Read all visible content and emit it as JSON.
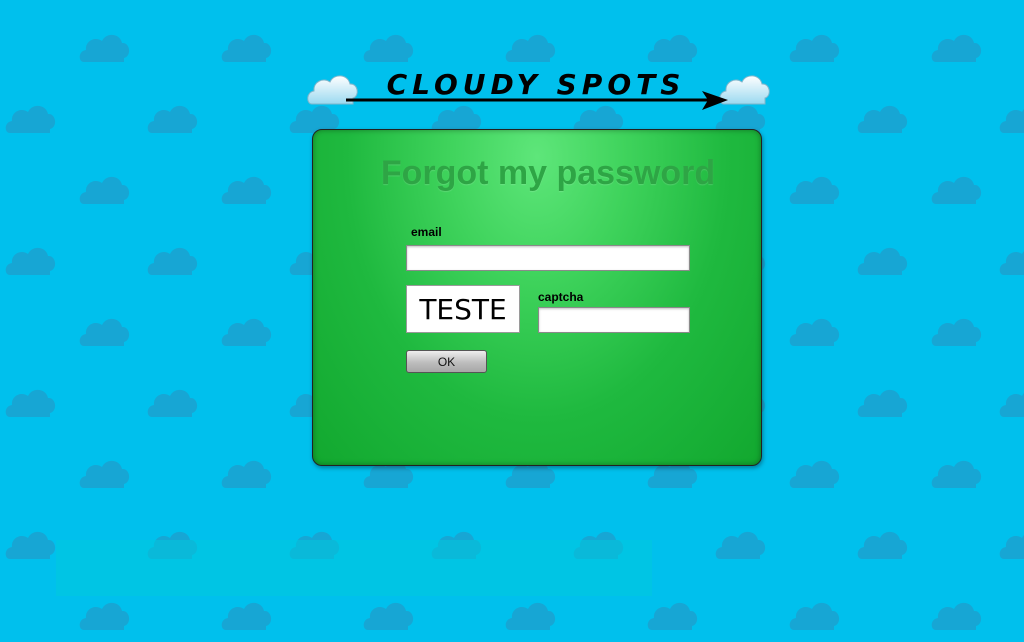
{
  "site": {
    "logo_text": "CLOUDY SPOTS"
  },
  "form": {
    "title": "Forgot my password",
    "email_label": "email",
    "email_value": "",
    "captcha_image_text": "TESTE",
    "captcha_label": "captcha",
    "captcha_value": "",
    "submit_label": "OK"
  },
  "colors": {
    "background": "#00c0ed",
    "panel_green": "#1fb93f",
    "title_green": "#2ea545"
  },
  "icons": {
    "background_pattern": "cloud-icon",
    "logo_clouds": "cloud-icon",
    "logo_arrow": "arrow-icon"
  }
}
